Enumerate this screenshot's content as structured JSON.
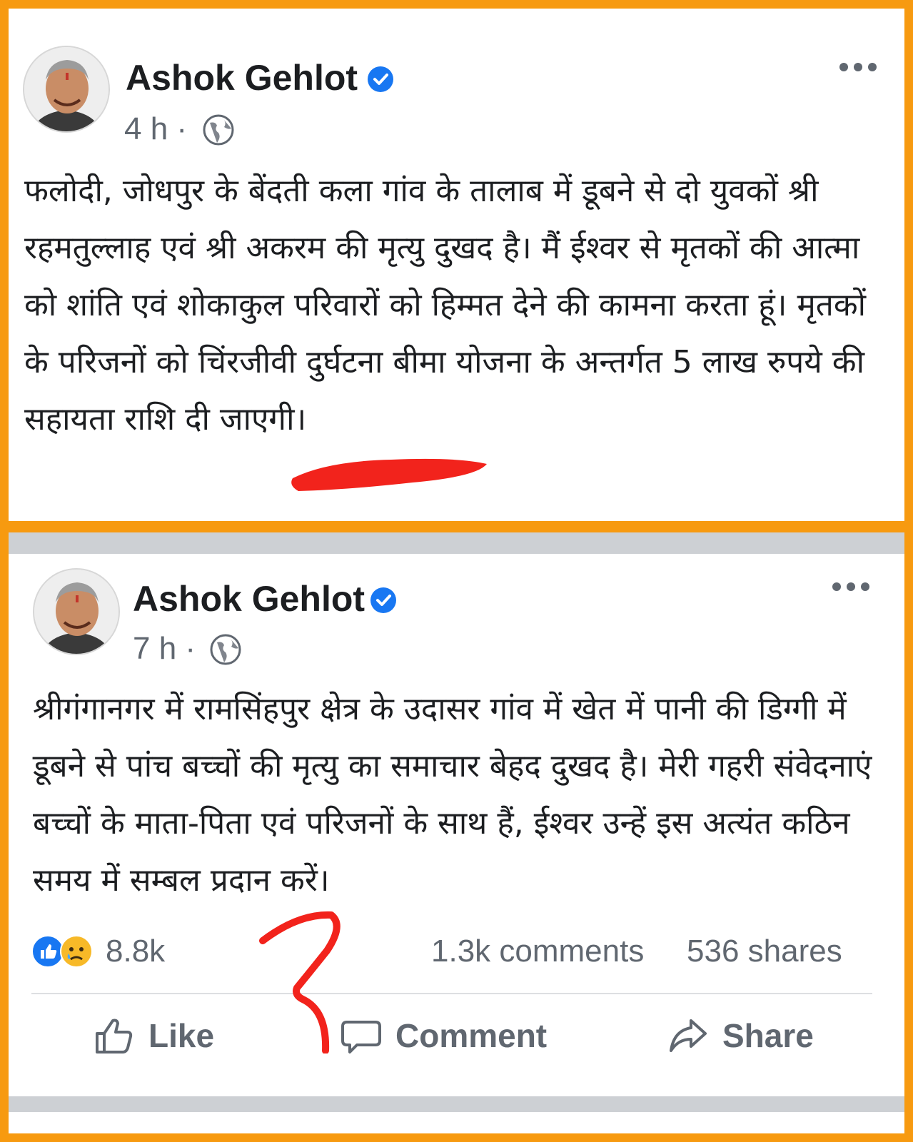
{
  "posts": [
    {
      "author": "Ashok Gehlot",
      "time": "4 h",
      "separator": "·",
      "text": "फलोदी, जोधपुर के बेंदती कला गांव के तालाब में डूबने से दो युवकों श्री रहमतुल्लाह एवं श्री अकरम की मृत्यु दुखद है। मैं ईश्वर से मृतकों की आत्मा को शांति एवं शोकाकुल परिवारों को हिम्मत देने की कामना करता हूं। मृतकों के परिजनों को चिंरजीवी दुर्घटना बीमा योजना के अन्तर्गत 5 लाख रुपये की सहायता राशि दी जाएगी।"
    },
    {
      "author": "Ashok Gehlot",
      "time": "7 h",
      "separator": "·",
      "text": "श्रीगंगानगर में रामसिंहपुर क्षेत्र के उदासर गांव में खेत में पानी की डिग्गी में डूबने से पांच बच्चों की मृत्यु का समाचार बेहद दुखद है। मेरी गहरी संवेदनाएं बच्चों के माता-पिता एवं परिजनों के साथ हैं, ईश्वर उन्हें इस अत्यंत कठिन समय में सम्बल प्रदान करें।",
      "reactions_count": "8.8k",
      "comments": "1.3k comments",
      "shares": "536 shares",
      "actions": {
        "like": "Like",
        "comment": "Comment",
        "share": "Share"
      }
    }
  ],
  "colors": {
    "frame": "#f79a10",
    "verified": "#1877f2",
    "annotation": "#f2231c",
    "secondary_text": "#606770"
  },
  "icons": [
    "verified-badge-icon",
    "globe-icon",
    "more-options-icon",
    "like-reaction-icon",
    "sad-reaction-icon",
    "thumbs-up-icon",
    "comment-bubble-icon",
    "share-arrow-icon"
  ]
}
